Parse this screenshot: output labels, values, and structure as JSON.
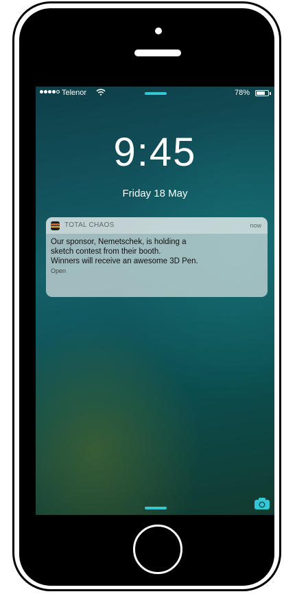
{
  "status_bar": {
    "carrier": "Telenor",
    "battery_percent": "78%",
    "battery_level": 0.78,
    "signal_bars_filled": 4,
    "signal_bars_total": 5
  },
  "lock_screen": {
    "time": "9:45",
    "date": "Friday 18 May"
  },
  "notification": {
    "app_name": "TOTAL CHAOS",
    "time": "now",
    "lines": [
      "Our sponsor, Nemetschek, is holding a",
      "sketch contest from their booth.",
      "Winners will receive an awesome 3D Pen."
    ],
    "action": "Open"
  },
  "icons": {
    "wifi": "wifi-icon",
    "battery": "battery-icon",
    "camera": "camera-icon",
    "app": "app-icon"
  },
  "colors": {
    "accent_cyan": "#34c7d6",
    "app_icon_orange": "#e0572f",
    "app_icon_yellow": "#f2b01e"
  }
}
